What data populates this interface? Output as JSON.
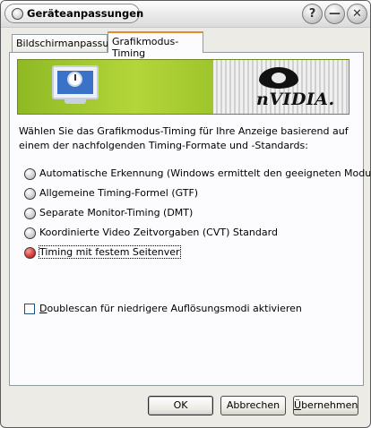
{
  "window": {
    "title": "Geräteanpassungen",
    "controls": [
      "?",
      "—",
      "✕"
    ]
  },
  "tabs": [
    {
      "label": "Bildschirmanpassung",
      "active": false
    },
    {
      "label": "Grafikmodus-Timing",
      "active": true
    }
  ],
  "banner": {
    "brand_text": "nVIDIA."
  },
  "description": "Wählen Sie das Grafikmodus-Timing für Ihre Anzeige basierend auf einem der nachfolgenden Timing-Formate und -Standards:",
  "options": [
    {
      "label": "Automatische Erkennung (Windows ermittelt den geeigneten Modus)",
      "checked": false
    },
    {
      "label": "Allgemeine Timing-Formel (GTF)",
      "checked": false
    },
    {
      "label": "Separate Monitor-Timing (DMT)",
      "checked": false
    },
    {
      "label": "Koordinierte Video Zeitvorgaben (CVT) Standard",
      "checked": false
    },
    {
      "label": "Timing mit festem Seitenver",
      "checked": true
    }
  ],
  "doublescan": {
    "first_letter": "D",
    "rest": "oublescan für niedrigere Auflösungsmodi aktivieren",
    "checked": false
  },
  "buttons": {
    "ok": "OK",
    "cancel": "Abbrechen",
    "apply_first": "Ü",
    "apply_rest": "bernehmen"
  }
}
